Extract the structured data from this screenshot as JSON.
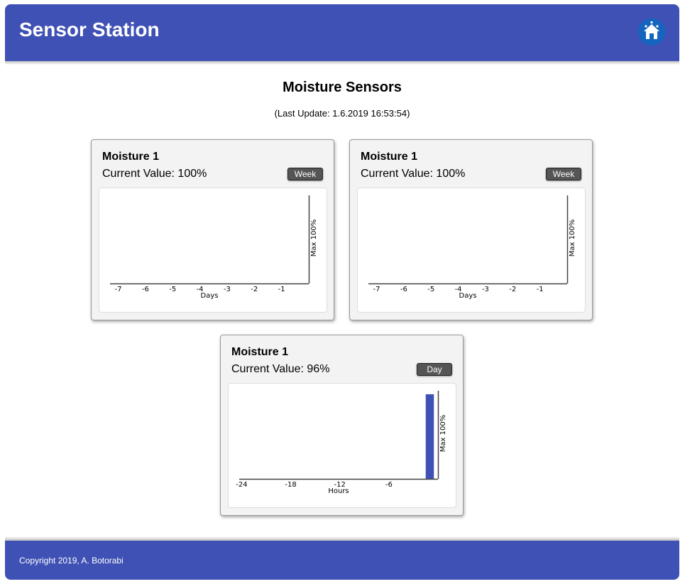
{
  "header": {
    "title": "Sensor Station",
    "home_icon": "home-icon"
  },
  "main": {
    "title": "Moisture Sensors",
    "last_update": "(Last Update: 1.6.2019 16:53:54)"
  },
  "cards": [
    {
      "title": "Moisture 1",
      "current_value": "Current Value: 100%",
      "range_button": "Week"
    },
    {
      "title": "Moisture 1",
      "current_value": "Current Value: 100%",
      "range_button": "Week"
    },
    {
      "title": "Moisture 1",
      "current_value": "Current Value: 96%",
      "range_button": "Day"
    }
  ],
  "chart_data": [
    {
      "type": "bar",
      "xlabel": "Days",
      "ylabel": "Max 100%",
      "x_ticks": [
        "-7",
        "-6",
        "-5",
        "-4",
        "-3",
        "-2",
        "-1"
      ],
      "xlim": [
        -7.3,
        0
      ],
      "ylim": [
        0,
        100
      ],
      "bars": [],
      "bar_color": "#3f51b5"
    },
    {
      "type": "bar",
      "xlabel": "Days",
      "ylabel": "Max 100%",
      "x_ticks": [
        "-7",
        "-6",
        "-5",
        "-4",
        "-3",
        "-2",
        "-1"
      ],
      "xlim": [
        -7.3,
        0
      ],
      "ylim": [
        0,
        100
      ],
      "bars": [],
      "bar_color": "#3f51b5"
    },
    {
      "type": "bar",
      "xlabel": "Hours",
      "ylabel": "Max 100%",
      "x_ticks": [
        "-24",
        "-18",
        "-12",
        "-6"
      ],
      "xlim": [
        -24.3,
        0
      ],
      "ylim": [
        0,
        100
      ],
      "bars": [
        {
          "x": -1,
          "value": 96
        }
      ],
      "bar_color": "#3f51b5"
    }
  ],
  "footer": {
    "copyright": "Copyright 2019, A. Botorabi"
  }
}
